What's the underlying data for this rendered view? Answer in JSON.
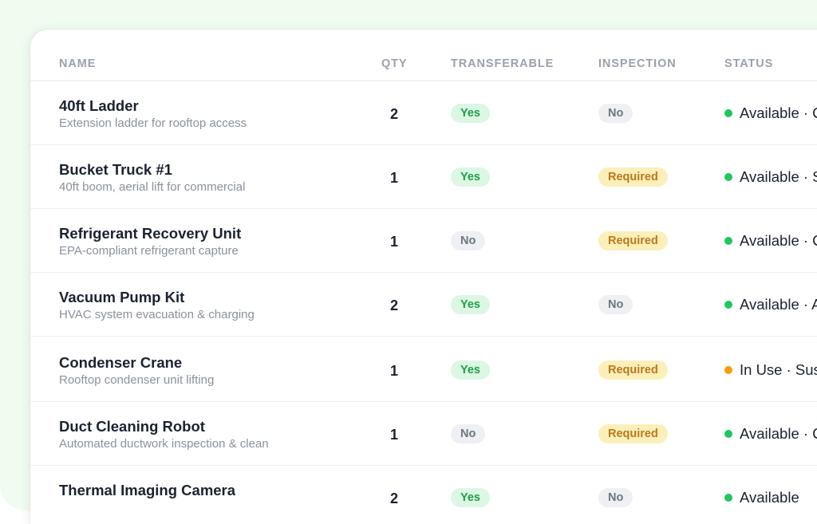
{
  "table": {
    "headers": {
      "name": "NAME",
      "qty": "QTY",
      "transferable": "TRANSFERABLE",
      "inspection": "INSPECTION",
      "status": "STATUS"
    },
    "rows": [
      {
        "name": "40ft Ladder",
        "desc": "Extension ladder for rooftop access",
        "qty": "2",
        "transferable": "Yes",
        "inspection": "No",
        "status": "Available · C",
        "status_color": "#22c55e"
      },
      {
        "name": "Bucket Truck #1",
        "desc": "40ft boom, aerial lift for commercial",
        "qty": "1",
        "transferable": "Yes",
        "inspection": "Required",
        "status": "Available · S",
        "status_color": "#22c55e"
      },
      {
        "name": "Refrigerant Recovery Unit",
        "desc": "EPA-compliant refrigerant capture",
        "qty": "1",
        "transferable": "No",
        "inspection": "Required",
        "status": "Available · C",
        "status_color": "#22c55e"
      },
      {
        "name": "Vacuum Pump Kit",
        "desc": "HVAC system evacuation & charging",
        "qty": "2",
        "transferable": "Yes",
        "inspection": "No",
        "status": "Available · A",
        "status_color": "#22c55e"
      },
      {
        "name": "Condenser Crane",
        "desc": "Rooftop condenser unit lifting",
        "qty": "1",
        "transferable": "Yes",
        "inspection": "Required",
        "status": "In Use · Sus",
        "status_color": "#f59e0b"
      },
      {
        "name": "Duct Cleaning Robot",
        "desc": "Automated ductwork inspection & clean",
        "qty": "1",
        "transferable": "No",
        "inspection": "Required",
        "status": "Available · C",
        "status_color": "#22c55e"
      },
      {
        "name": "Thermal Imaging Camera",
        "desc": "",
        "qty": "2",
        "transferable": "Yes",
        "inspection": "No",
        "status": "Available",
        "status_color": "#22c55e"
      }
    ]
  },
  "colors": {
    "page_background": "#f1fcf1",
    "yes_pill": "#dcf7e3",
    "required_pill": "#fdefb9",
    "no_pill": "#eef0f3",
    "available_dot": "#22c55e",
    "in_use_dot": "#f59e0b"
  }
}
